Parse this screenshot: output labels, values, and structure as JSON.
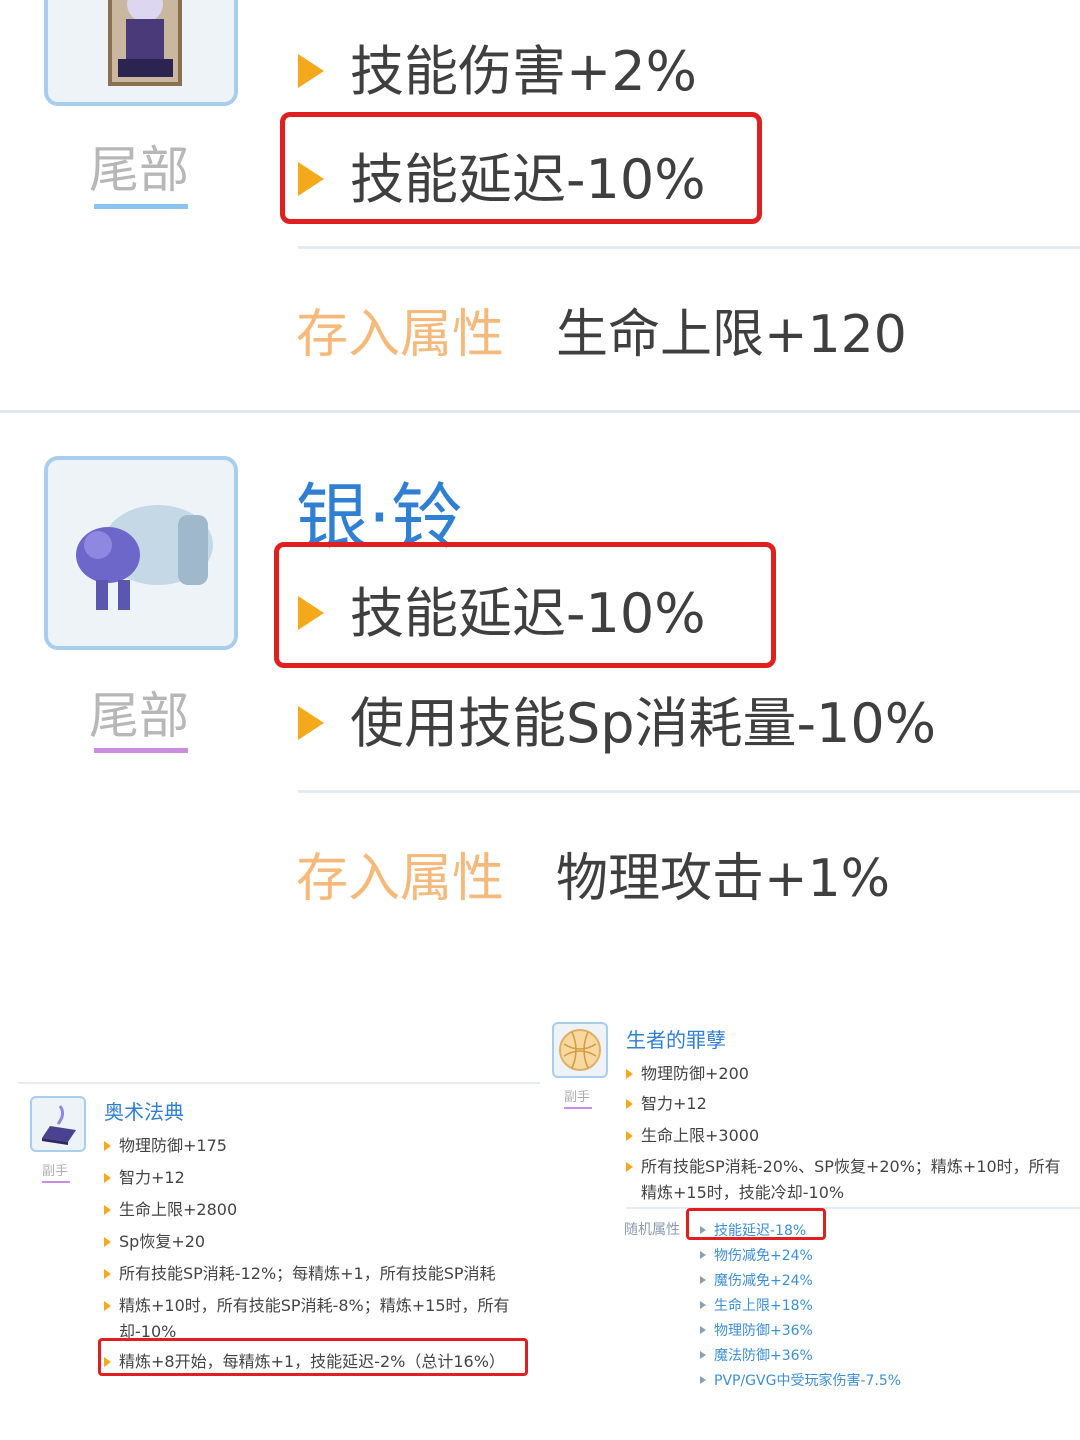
{
  "panel1": {
    "slot": "尾部",
    "lines": [
      "技能伤害+2%",
      "技能延迟-10%"
    ],
    "stored_label": "存入属性",
    "stored_value": "生命上限+120",
    "icon": "tail-character-icon"
  },
  "panel2": {
    "title": "银·铃",
    "slot": "尾部",
    "lines": [
      "技能延迟-10%",
      "使用技能Sp消耗量-10%"
    ],
    "stored_label": "存入属性",
    "stored_value": "物理攻击+1%",
    "icon": "silver-bell-icon"
  },
  "panel3": {
    "title": "奥术法典",
    "slot": "副手",
    "lines": [
      "物理防御+175",
      "智力+12",
      "生命上限+2800",
      "Sp恢复+20",
      "所有技能SP消耗-12%；每精炼+1，所有技能SP消耗",
      "精炼+10时，所有技能SP消耗-8%；精炼+15时，所有",
      "却-10%",
      "精炼+8开始，每精炼+1，技能延迟-2%（总计16%）"
    ],
    "icon": "arcane-book-icon"
  },
  "panel4": {
    "title": "生者的罪孽",
    "slot": "副手",
    "lines": [
      "物理防御+200",
      "智力+12",
      "生命上限+3000",
      "所有技能SP消耗-20%、SP恢复+20%；精炼+10时，所有",
      "精炼+15时，技能冷却-10%"
    ],
    "random_label": "随机属性",
    "random_lines": [
      "技能延迟-18%",
      "物伤减免+24%",
      "魔伤减免+24%",
      "生命上限+18%",
      "物理防御+36%",
      "魔法防御+36%",
      "PVP/GVG中受玩家伤害-7.5%"
    ],
    "icon": "sin-orb-icon"
  },
  "colors": {
    "accent_blue": "#2f7fd3",
    "bullet_orange": "#f3a91b",
    "highlight_red": "#e02020",
    "stored_label_orange": "#f6b97c"
  }
}
